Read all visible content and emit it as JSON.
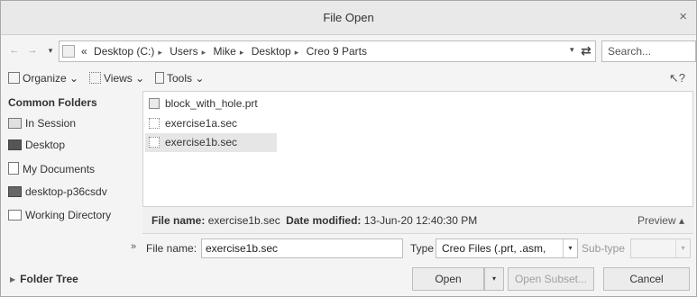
{
  "window": {
    "title": "File Open",
    "close_glyph": "×"
  },
  "address_bar": {
    "back_glyph": "←",
    "forward_glyph": "→",
    "history_dropdown_glyph": "▾",
    "path_prefix": "«",
    "crumbs": [
      "Desktop (C:)",
      "Users",
      "Mike",
      "Desktop",
      "Creo 9 Parts"
    ],
    "crumb_separator": "▸",
    "path_dropdown_glyph": "▾",
    "refresh_glyph": "⇄",
    "search_placeholder": "Search..."
  },
  "toolbar": {
    "organize_label": "Organize ⌄",
    "views_label": "Views ⌄",
    "tools_label": "Tools ⌄",
    "help_glyph": "↖?"
  },
  "sidebar": {
    "heading": "Common Folders",
    "items": [
      {
        "label": "In Session",
        "icon": "monitor-icon"
      },
      {
        "label": "Desktop",
        "icon": "desktop-icon"
      },
      {
        "label": "My Documents",
        "icon": "documents-icon"
      },
      {
        "label": "desktop-p36csdv",
        "icon": "computer-icon"
      },
      {
        "label": "Working Directory",
        "icon": "folder-star-icon"
      }
    ],
    "expand_glyph": "»"
  },
  "files": [
    {
      "name": "block_with_hole.prt",
      "icon": "part-icon",
      "selected": false
    },
    {
      "name": "exercise1a.sec",
      "icon": "section-icon",
      "selected": false
    },
    {
      "name": "exercise1b.sec",
      "icon": "section-icon",
      "selected": true
    }
  ],
  "info_bar": {
    "file_name_label": "File name:",
    "file_name_value": "exercise1b.sec",
    "date_label": "Date modified:",
    "date_value": "13-Jun-20 12:40:30 PM",
    "preview_label": "Preview ▴"
  },
  "name_row": {
    "file_name_label": "File name:",
    "file_name_value": "exercise1b.sec",
    "type_label": "Type",
    "type_value": "Creo Files (.prt, .asm,",
    "dropdown_glyph": "▾",
    "subtype_label": "Sub-type"
  },
  "footer": {
    "folder_tree_label": "Folder Tree",
    "folder_tree_glyph": "▶",
    "open_label": "Open",
    "open_dropdown_glyph": "▾",
    "open_subset_label": "Open Subset...",
    "cancel_label": "Cancel"
  }
}
